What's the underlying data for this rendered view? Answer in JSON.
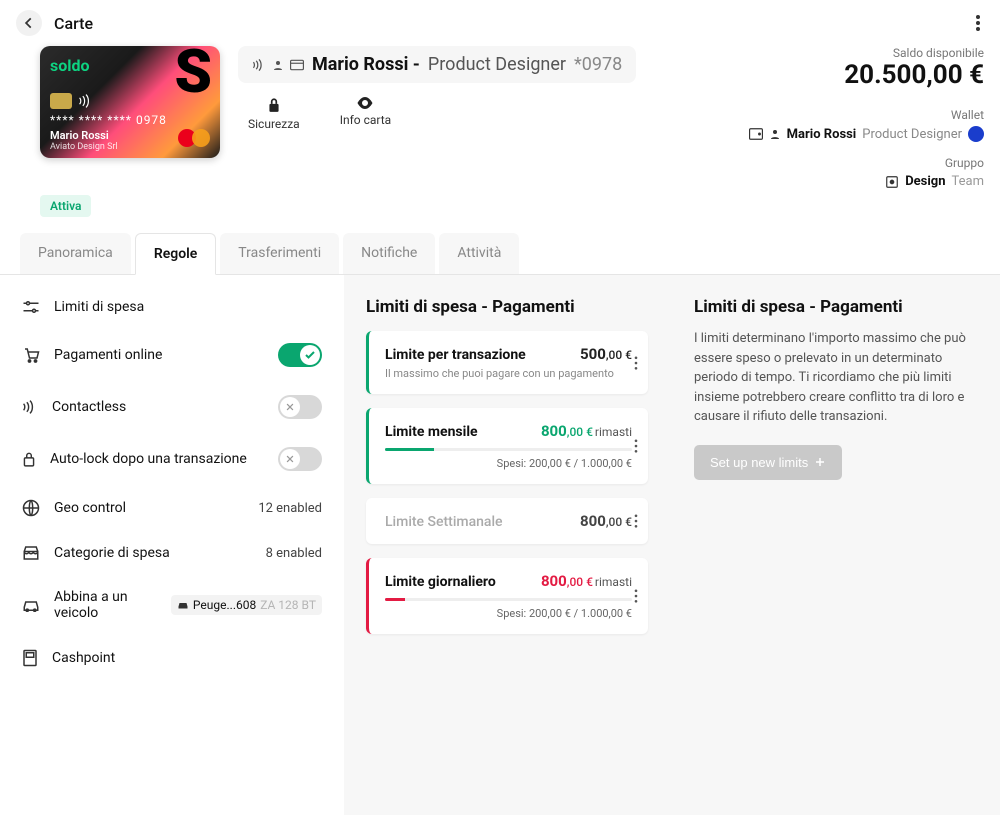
{
  "header": {
    "title": "Carte"
  },
  "card": {
    "brand": "soldo",
    "masked": "**** **** **** 0978",
    "holder": "Mario Rossi",
    "company": "Aviato Design Srl",
    "status": "Attiva"
  },
  "meta": {
    "name": "Mario Rossi -",
    "role": "Product Designer",
    "last4": "*0978"
  },
  "actions": {
    "security": "Sicurezza",
    "info": "Info carta"
  },
  "balance": {
    "label": "Saldo disponibile",
    "amount": "20.500,00 €"
  },
  "wallet": {
    "label": "Wallet",
    "name": "Mario Rossi",
    "role": "Product Designer"
  },
  "group": {
    "label": "Gruppo",
    "name": "Design",
    "team": "Team"
  },
  "tabs": {
    "overview": "Panoramica",
    "rules": "Regole",
    "transfers": "Trasferimenti",
    "notifications": "Notifiche",
    "activity": "Attività"
  },
  "sidebar": {
    "spend_limits": "Limiti di spesa",
    "online_payments": "Pagamenti online",
    "contactless": "Contactless",
    "autolock": "Auto-lock dopo una transazione",
    "geo": "Geo control",
    "geo_val": "12 enabled",
    "categories": "Categorie di spesa",
    "categories_val": "8 enabled",
    "vehicle": "Abbina a un veicolo",
    "vehicle_name": "Peuge...608",
    "vehicle_plate": "ZA 128 BT",
    "cashpoint": "Cashpoint"
  },
  "limits": {
    "title": "Limiti di spesa - Pagamenti",
    "per_tx": {
      "title": "Limite per transazione",
      "amount": "500",
      "cents": ",00 €",
      "sub": "Il massimo che puoi pagare con un pagamento"
    },
    "monthly": {
      "title": "Limite mensile",
      "amount": "800",
      "cents": ",00 €",
      "suffix": "rimasti",
      "spent": "Spesi: 200,00 € / 1.000,00 €"
    },
    "weekly": {
      "title": "Limite Settimanale",
      "amount": "800",
      "cents": ",00 €"
    },
    "daily": {
      "title": "Limite giornaliero",
      "amount": "800",
      "cents": ",00 €",
      "suffix": "rimasti",
      "spent": "Spesi: 200,00 € / 1.000,00 €"
    }
  },
  "info_panel": {
    "title": "Limiti di spesa - Pagamenti",
    "text": "I limiti determinano l'importo massimo che può essere speso o prelevato in un determinato periodo di tempo. Ti ricordiamo che più limiti insieme potrebbero creare conflitto tra di loro e causare il rifiuto delle transazioni.",
    "button": "Set up new limits"
  }
}
